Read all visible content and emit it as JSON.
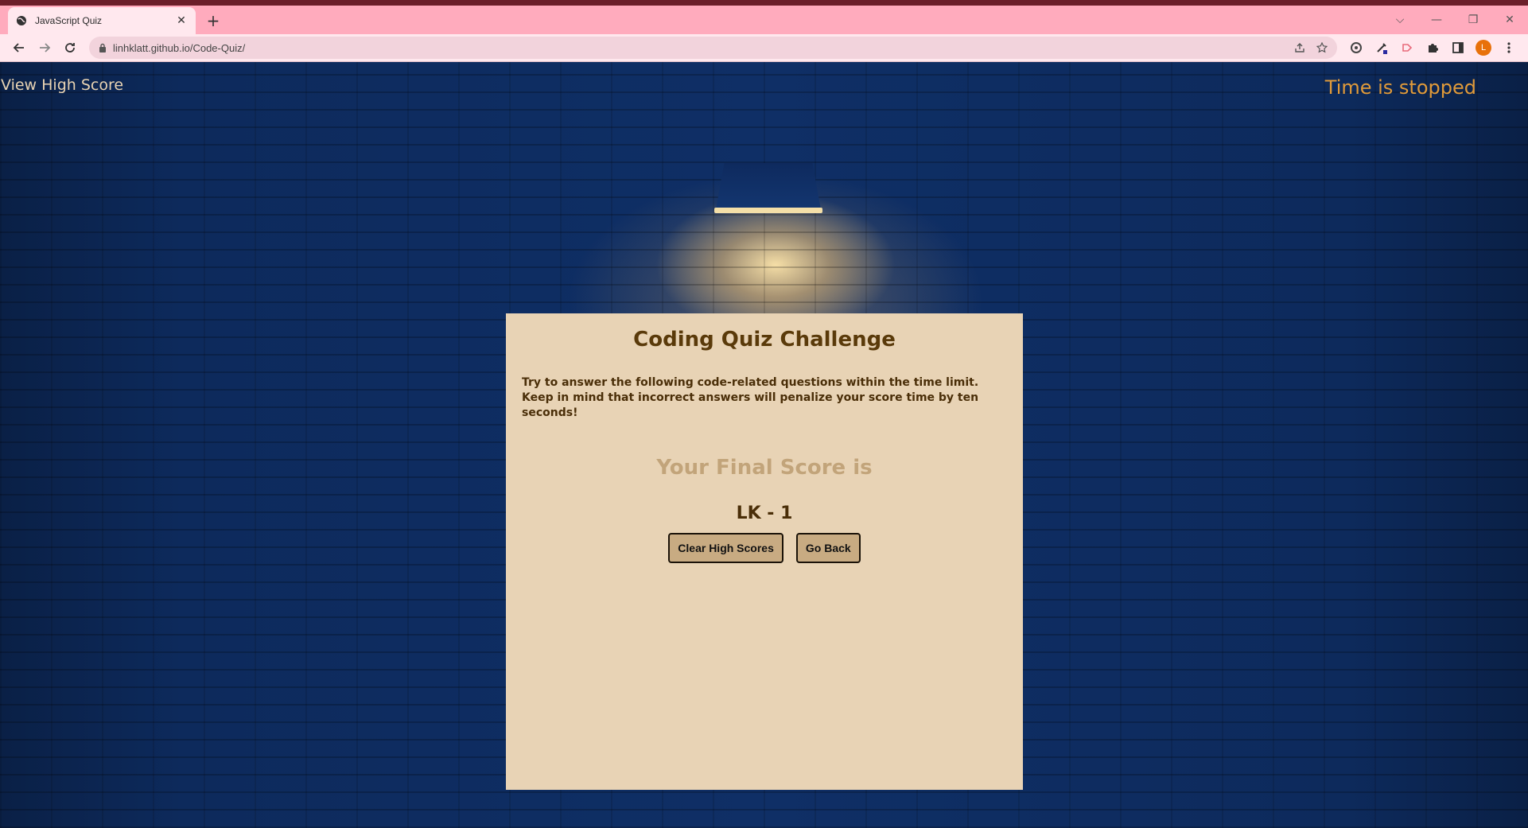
{
  "browser": {
    "tab_title": "JavaScript Quiz",
    "tab_close": "✕",
    "new_tab": "+",
    "url": "linhklatt.github.io/Code-Quiz/",
    "avatar_letter": "L",
    "window_controls": {
      "chevron": "⌵",
      "minimize": "—",
      "restore": "❐",
      "close": "✕"
    }
  },
  "header": {
    "view_high_score": "View High Score",
    "timer_text": "Time is stopped"
  },
  "quiz": {
    "title": "Coding Quiz Challenge",
    "instructions": "Try to answer the following code-related questions within the time limit. Keep in mind that incorrect answers will penalize your score time by ten seconds!",
    "final_score_heading": "Your Final Score is",
    "score_entry": "LK - 1",
    "buttons": {
      "clear": "Clear High Scores",
      "back": "Go Back"
    }
  },
  "colors": {
    "tabbar": "#ffabbd",
    "card": "#e8d3b5",
    "timer": "#e09a3a",
    "button": "#c8ab82"
  }
}
